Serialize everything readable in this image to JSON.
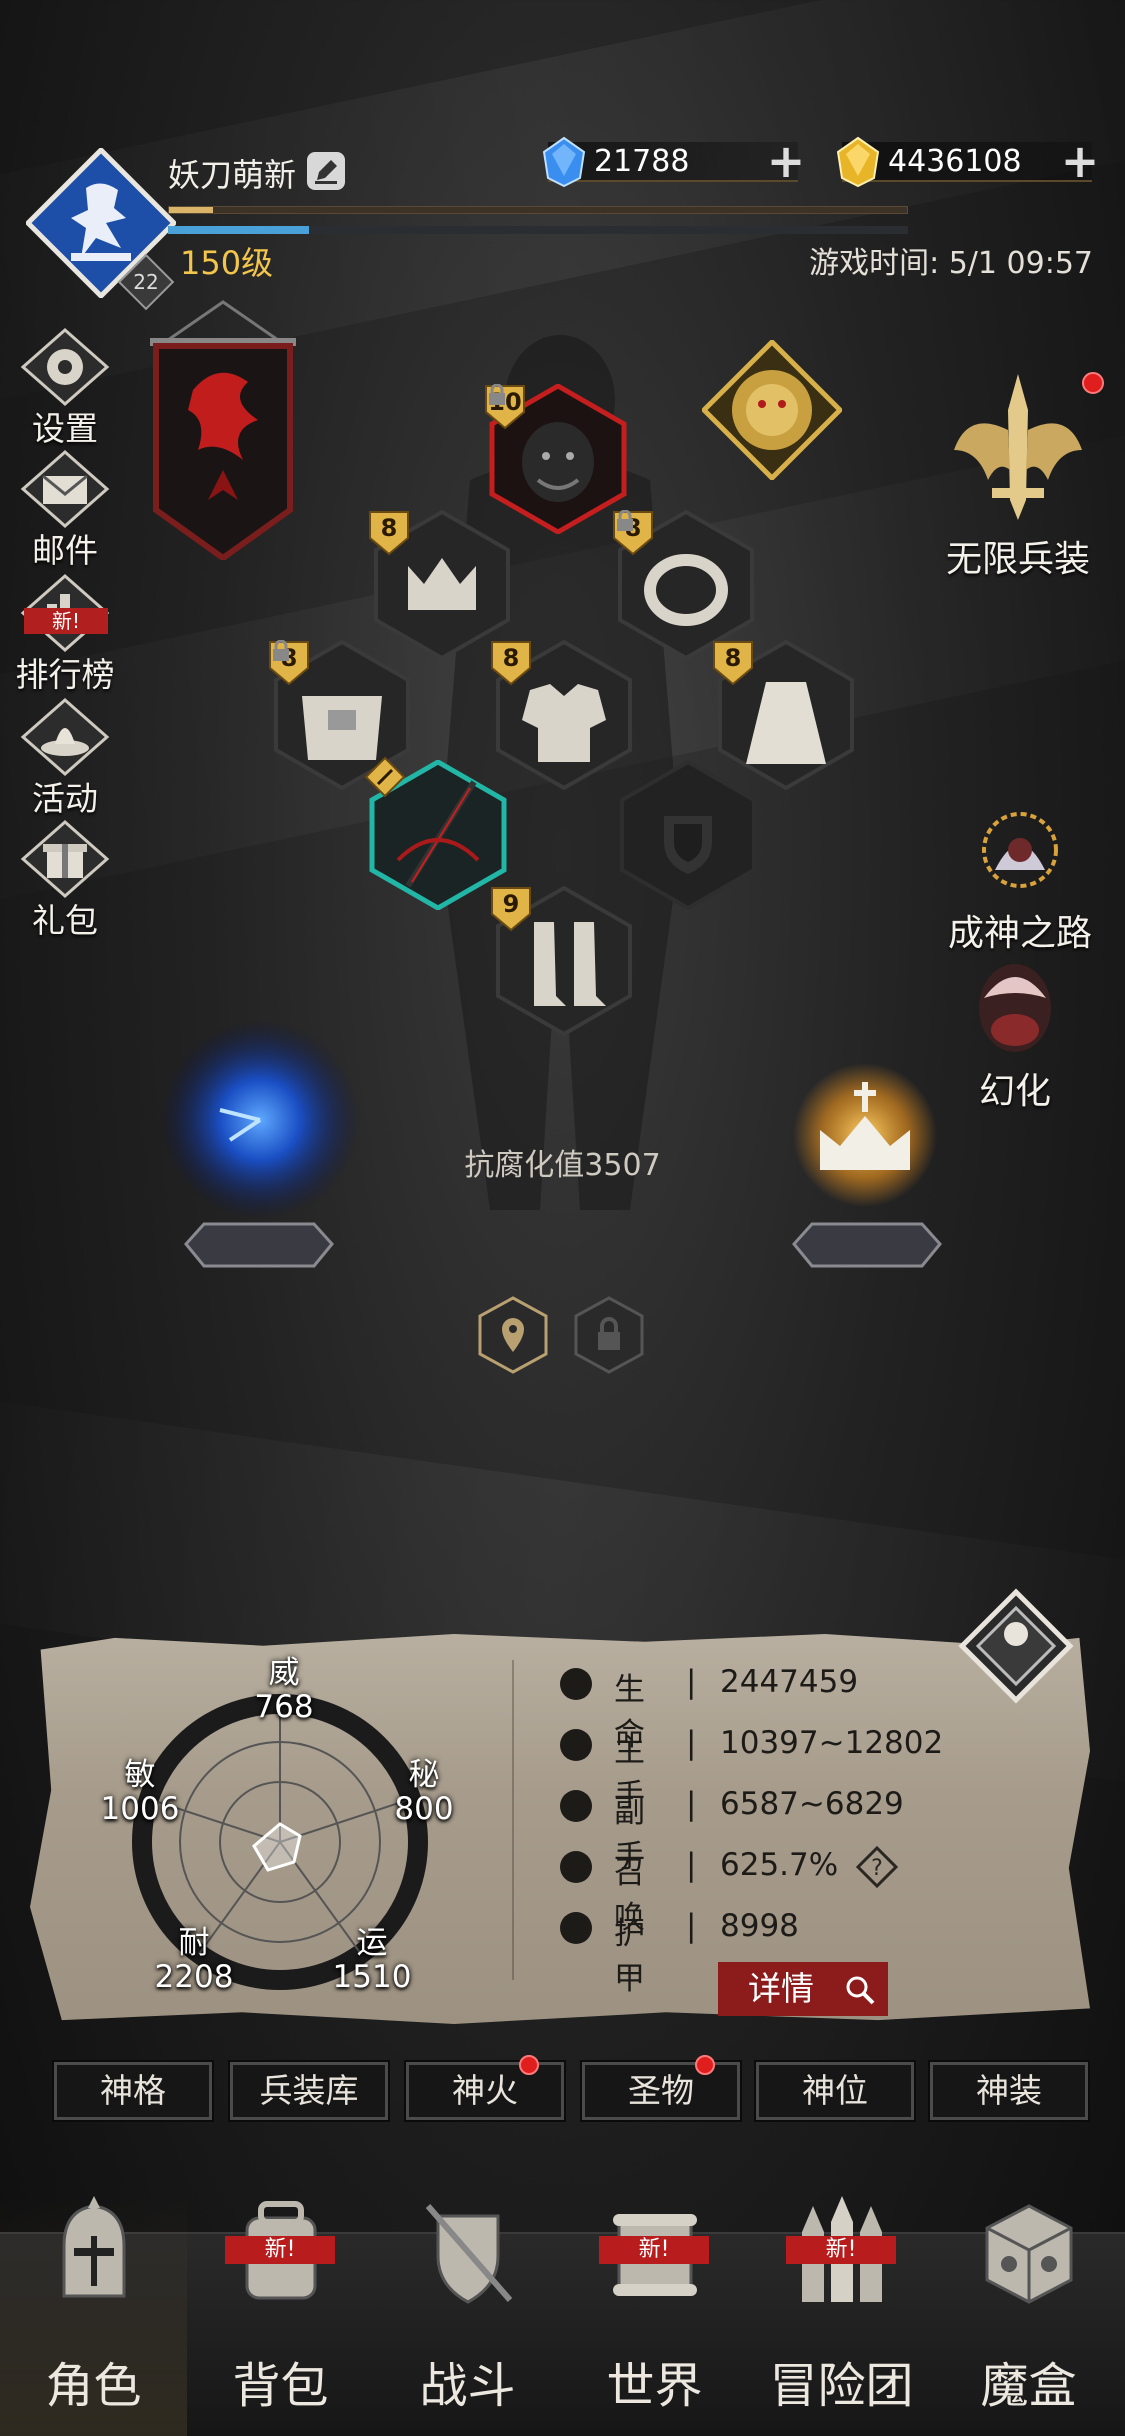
{
  "player": {
    "name": "妖刀萌新",
    "avatar_level": "22",
    "level": "150级",
    "xp_fraction": 0.06,
    "mp_fraction": 0.19
  },
  "header": {
    "game_time": "游戏时间: 5/1 09:57"
  },
  "currency": {
    "gems": "21788",
    "gold": "4436108"
  },
  "left_menu": [
    {
      "label": "设置",
      "icon": "gear-icon"
    },
    {
      "label": "邮件",
      "icon": "mail-icon"
    },
    {
      "label": "排行榜",
      "icon": "ranking-icon",
      "badge": "新!"
    },
    {
      "label": "活动",
      "icon": "event-icon"
    },
    {
      "label": "礼包",
      "icon": "gift-icon"
    }
  ],
  "right_menu": {
    "infinite_weapons": "无限兵装",
    "path_to_godhood": "成神之路",
    "transform": "幻化"
  },
  "equipment": {
    "helmet_tier": "10",
    "crown_tier": "8",
    "ring_tier": "8",
    "belt_tier": "8",
    "armor_tier": "8",
    "cloak_tier": "8",
    "boots_tier": "9"
  },
  "corruption_resist": "抗腐化值3507",
  "attributes": {
    "wei_label": "威",
    "wei_value": "768",
    "min_label": "敏",
    "min_value": "1006",
    "mi_label": "秘",
    "mi_value": "800",
    "nai_label": "耐",
    "nai_value": "2208",
    "yun_label": "运",
    "yun_value": "1510"
  },
  "stats": [
    {
      "name": "生命",
      "value": "2447459",
      "icon": "heart-icon"
    },
    {
      "name": "主手",
      "value": "10397~12802",
      "icon": "main-hand-icon"
    },
    {
      "name": "副手",
      "value": "6587~6829",
      "icon": "off-hand-icon"
    },
    {
      "name": "召唤",
      "value": "625.7%",
      "icon": "summon-icon"
    },
    {
      "name": "护甲",
      "value": "8998",
      "icon": "armor-icon"
    }
  ],
  "stat_separator": "|",
  "help_glyph": "?",
  "detail_button": "详情",
  "tabs": [
    {
      "label": "神格"
    },
    {
      "label": "兵装库"
    },
    {
      "label": "神火",
      "dot": true
    },
    {
      "label": "圣物",
      "dot": true
    },
    {
      "label": "神位"
    },
    {
      "label": "神装"
    }
  ],
  "bottom_nav": [
    {
      "label": "角色",
      "active": true
    },
    {
      "label": "背包",
      "badge": "新!"
    },
    {
      "label": "战斗"
    },
    {
      "label": "世界",
      "badge": "新!"
    },
    {
      "label": "冒险团",
      "badge": "新!"
    },
    {
      "label": "魔盒"
    }
  ],
  "colors": {
    "gold_text": "#f3c64b",
    "red_badge": "#b21f1f",
    "panel_paper": "#a79c8c",
    "detail_button": "#8c1c1c",
    "mp_bar": "#4aa0d8"
  }
}
